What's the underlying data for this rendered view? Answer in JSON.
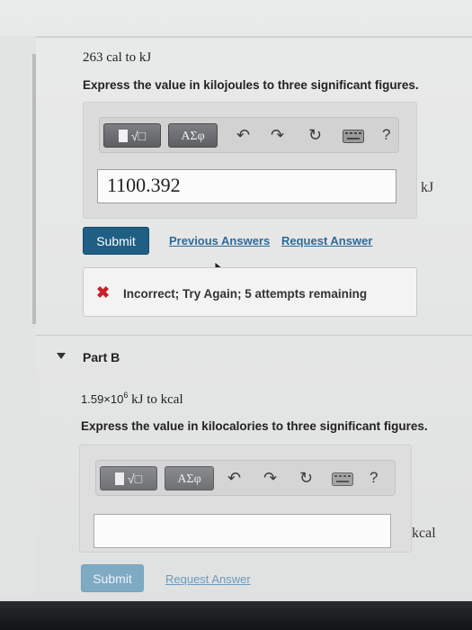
{
  "part_a": {
    "question": "263 cal to kJ",
    "instruction": "Express the value in kilojoules to three significant figures.",
    "toolbar": {
      "templates_label": "√□",
      "greek_label": "ΑΣφ",
      "undo_icon": "undo-icon",
      "redo_icon": "redo-icon",
      "reset_icon": "reset-icon",
      "keyboard_icon": "keyboard-icon",
      "help_label": "?"
    },
    "answer_value": "1100.392",
    "unit": "kJ",
    "submit_label": "Submit",
    "previous_answers_label": "Previous Answers",
    "request_answer_label": "Request Answer",
    "feedback": "Incorrect; Try Again; 5 attempts remaining"
  },
  "part_b": {
    "label": "Part B",
    "question_prefix": "1.59×10",
    "question_exp": "6",
    "question_suffix": " kJ to kcal",
    "instruction": "Express the value in kilocalories to three significant figures.",
    "toolbar": {
      "templates_label": "√□",
      "greek_label": "ΑΣφ",
      "help_label": "?"
    },
    "answer_value": "",
    "unit": "kcal",
    "submit_label": "Submit",
    "request_answer_label": "Request Answer"
  },
  "colors": {
    "submit": "#1f5f84",
    "link": "#2d6a9a",
    "error": "#c8202a"
  }
}
